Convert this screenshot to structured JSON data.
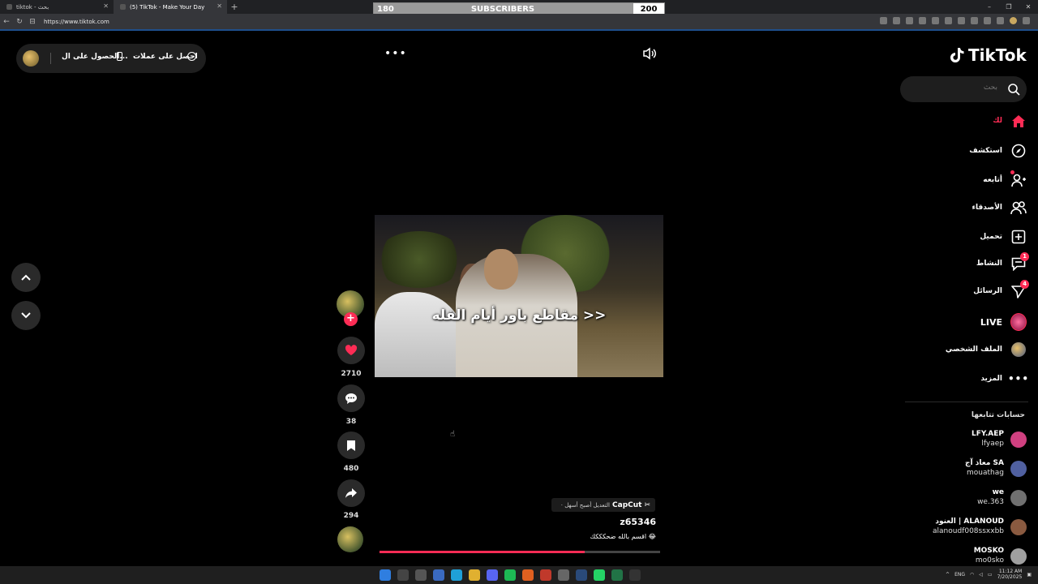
{
  "browser": {
    "tabs": [
      {
        "title": "tiktok - بحث",
        "active": false
      },
      {
        "title": "(5) TikTok - Make Your Day",
        "active": true
      }
    ],
    "url": "https://www.tiktok.com"
  },
  "subscriber_bar": {
    "label": "SUBSCRIBERS",
    "current": "180",
    "goal": "200",
    "progress_fraction": 0.9
  },
  "topbar": {
    "get_coins": "احصل على عملات",
    "get_app": "الحصول على ال...",
    "more": "•••"
  },
  "video": {
    "caption": "مقاطع باور أيام الفله >>",
    "capcut_brand": "CapCut",
    "capcut_tag": "· التعديل أصبح أسهل",
    "username": "z65346",
    "description": "اقسم بالله ضحكككك 😂",
    "progress_fraction": 0.73
  },
  "actions": {
    "likes": "2710",
    "comments": "38",
    "saves": "480",
    "shares": "294"
  },
  "sidebar": {
    "logo": "TikTok",
    "search_placeholder": "بحث",
    "items": [
      {
        "label": "لك",
        "icon": "home-icon",
        "active": true
      },
      {
        "label": "استكشف",
        "icon": "compass-icon"
      },
      {
        "label": "أتابعه",
        "icon": "follow-icon"
      },
      {
        "label": "الأصدقاء",
        "icon": "friends-icon"
      },
      {
        "label": "تحميل",
        "icon": "upload-icon"
      },
      {
        "label": "النشاط",
        "icon": "activity-icon",
        "badge": "1"
      },
      {
        "label": "الرسائل",
        "icon": "messages-icon",
        "badge": "4"
      },
      {
        "label": "LIVE",
        "icon": "live-icon"
      },
      {
        "label": "الملف الشخصي",
        "icon": "profile-icon"
      },
      {
        "label": "المزيد",
        "icon": "more-icon"
      }
    ],
    "following_title": "حسابات تتابعها",
    "following": [
      {
        "name": "LFY.AEP",
        "handle": "lfyaep",
        "color": "#d04080"
      },
      {
        "name": "معاذ آج SA",
        "handle": "mouathag",
        "color": "#5060a0"
      },
      {
        "name": "we",
        "handle": "we.363",
        "color": "#707070"
      },
      {
        "name": "العنود | ALANOUD",
        "handle": "alanoudf008ssxxbb",
        "color": "#8a5a40"
      },
      {
        "name": "MOSKO",
        "handle": "mo0sko",
        "color": "#a0a0a0"
      }
    ]
  },
  "taskbar": {
    "lang": "ENG",
    "time": "11:12 AM",
    "date": "7/20/2025"
  },
  "colors": {
    "accent": "#fe2c55",
    "background": "#000000"
  }
}
